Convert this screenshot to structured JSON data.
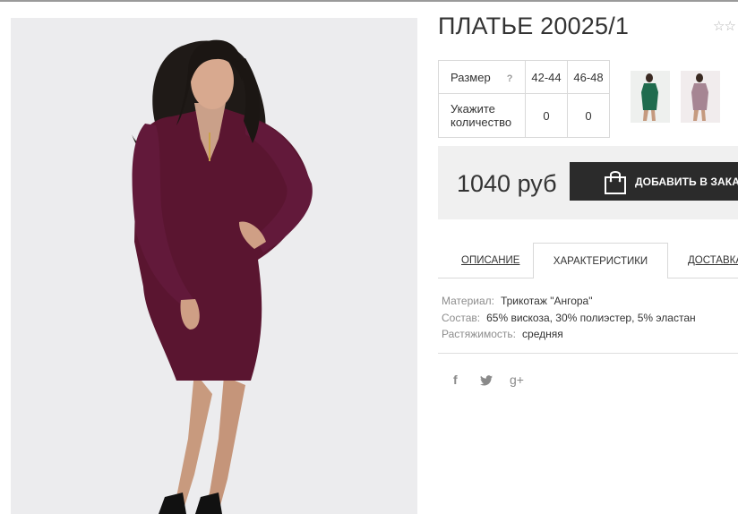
{
  "product": {
    "title": "ПЛАТЬЕ 20025/1",
    "rating_stars": "☆☆",
    "image": {
      "dress_color": "#5a1530",
      "background": "#ececee"
    },
    "thumbnails": [
      {
        "color": "#1f6b4e"
      },
      {
        "color": "#a68593"
      }
    ]
  },
  "sizes": {
    "size_label": "Размер",
    "help_icon": "?",
    "columns": [
      "42-44",
      "46-48"
    ],
    "qty_label_1": "Укажите",
    "qty_label_2": "количество",
    "quantities": [
      "0",
      "0"
    ]
  },
  "purchase": {
    "price": "1040 руб",
    "add_button_label": "ДОБАВИТЬ В ЗАКАЗ",
    "button_icon": "shopping-bag-icon",
    "button_color": "#2b2b2b"
  },
  "tabs": [
    {
      "label": "ОПИСАНИЕ",
      "active": false
    },
    {
      "label": "ХАРАКТЕРИСТИКИ",
      "active": true
    },
    {
      "label": "ДОСТАВКА",
      "active": false
    }
  ],
  "specs": [
    {
      "key": "Материал:",
      "value": "Трикотаж \"Ангора\""
    },
    {
      "key": "Состав:",
      "value": "65% вискоза, 30% полиэстер, 5% эластан"
    },
    {
      "key": "Растяжимость:",
      "value": "средняя"
    }
  ],
  "social": {
    "facebook": "f",
    "twitter_icon": "twitter-icon",
    "googleplus": "g+"
  }
}
